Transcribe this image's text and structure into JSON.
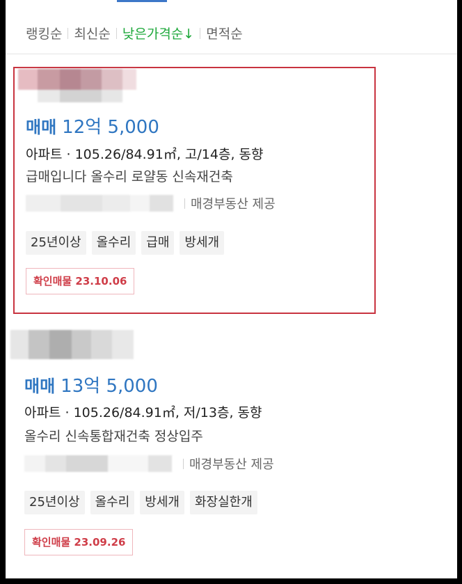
{
  "sort": {
    "items": [
      {
        "label": "랭킹순"
      },
      {
        "label": "최신순"
      },
      {
        "label": "낮은가격순↓"
      },
      {
        "label": "면적순"
      }
    ],
    "active_index": 2
  },
  "listings": [
    {
      "deal_type": "매매",
      "price": "12억 5,000",
      "spec_type": "아파트 ·",
      "spec_detail": " 105.26/84.91㎡, 고/14층, 동향",
      "description": "급매입니다 올수리 로얄동 신속재건축",
      "source": "매경부동산 제공",
      "tags": [
        "25년이상",
        "올수리",
        "급매",
        "방세개"
      ],
      "verify": "확인매물 23.10.06",
      "highlighted": true
    },
    {
      "deal_type": "매매",
      "price": "13억 5,000",
      "spec_type": "아파트 ·",
      "spec_detail": " 105.26/84.91㎡, 저/13층, 동향",
      "description": "올수리 신속통합재건축 정상입주",
      "source": "매경부동산 제공",
      "tags": [
        "25년이상",
        "올수리",
        "방세개",
        "화장실한개"
      ],
      "verify": "확인매물 23.09.26",
      "highlighted": false
    }
  ],
  "colors": {
    "accent_blue": "#2f76c1",
    "active_sort_green": "#1ea83b",
    "highlight_border": "#c8333f",
    "verify_red": "#cf3d48"
  }
}
